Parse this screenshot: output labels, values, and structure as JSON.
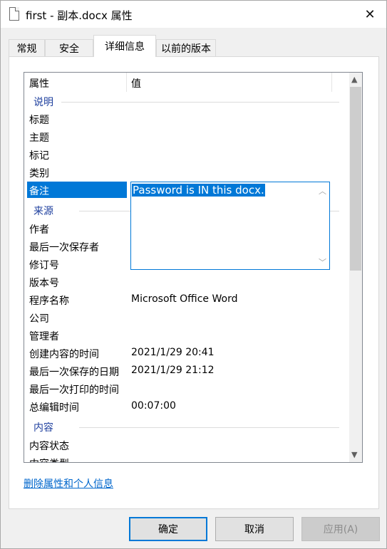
{
  "window": {
    "title": "first - 副本.docx 属性",
    "close_glyph": "✕"
  },
  "tabs": [
    {
      "label": "常规"
    },
    {
      "label": "安全"
    },
    {
      "label": "详细信息",
      "active": true
    },
    {
      "label": "以前的版本"
    }
  ],
  "list": {
    "columns": {
      "property": "属性",
      "value": "值"
    },
    "groups": {
      "description": "说明",
      "origin": "来源",
      "content": "内容"
    },
    "description_rows": [
      {
        "name": "标题",
        "value": ""
      },
      {
        "name": "主题",
        "value": ""
      },
      {
        "name": "标记",
        "value": ""
      },
      {
        "name": "类别",
        "value": ""
      },
      {
        "name": "备注",
        "value": ""
      }
    ],
    "origin_rows": [
      {
        "name": "作者",
        "value": ""
      },
      {
        "name": "最后一次保存者",
        "value": ""
      },
      {
        "name": "修订号",
        "value": ""
      },
      {
        "name": "版本号",
        "value": ""
      },
      {
        "name": "程序名称",
        "value": "Microsoft Office Word"
      },
      {
        "name": "公司",
        "value": ""
      },
      {
        "name": "管理者",
        "value": ""
      },
      {
        "name": "创建内容的时间",
        "value": "2021/1/29 20:41"
      },
      {
        "name": "最后一次保存的日期",
        "value": "2021/1/29 21:12"
      },
      {
        "name": "最后一次打印的时间",
        "value": ""
      },
      {
        "name": "总编辑时间",
        "value": "00:07:00"
      }
    ],
    "content_rows": [
      {
        "name": "内容状态",
        "value": ""
      },
      {
        "name": "内容类型",
        "value": ""
      }
    ],
    "comment_edit_value": "Password is IN this docx."
  },
  "link_text": "删除属性和个人信息",
  "buttons": {
    "ok": "确定",
    "cancel": "取消",
    "apply": "应用(A)"
  },
  "colors": {
    "accent": "#0078d7",
    "link": "#0066cc"
  }
}
